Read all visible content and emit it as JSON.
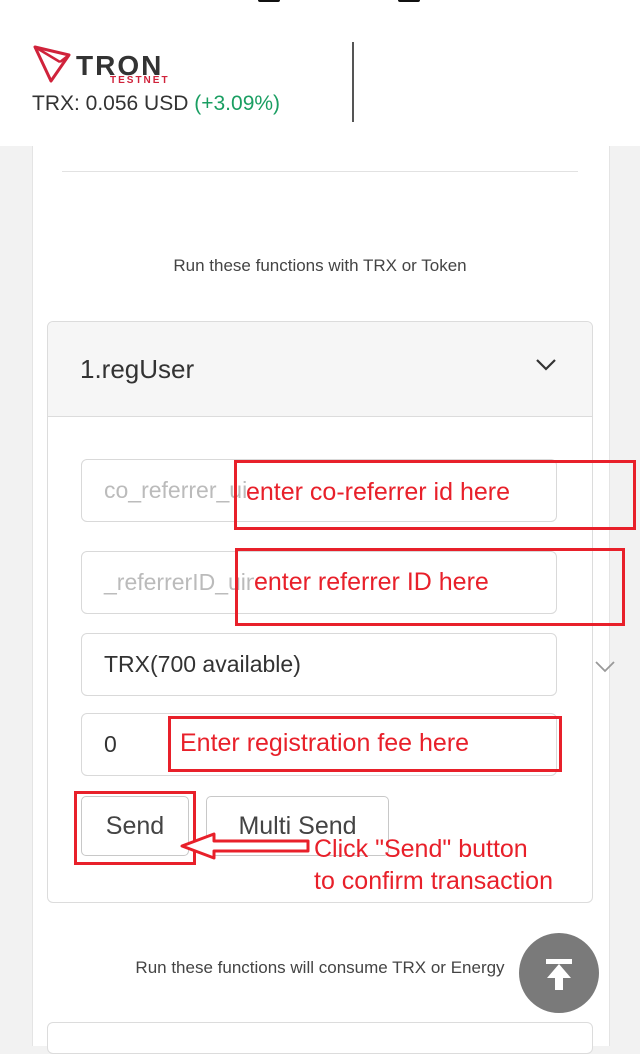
{
  "header": {
    "logo_word": "TRON",
    "logo_sub": "TESTNET",
    "price_label": "TRX: 0.056 USD",
    "price_change": "(+3.09%)",
    "brand_color": "#d0233b",
    "change_color": "#1a9e62"
  },
  "section_trx": {
    "caption": "Run these functions with TRX or Token"
  },
  "function_panel": {
    "title": "1.regUser",
    "co_referrer_placeholder": "co_referrer_uint256",
    "referrer_placeholder": "_referrerID_uint256",
    "token_select_value": "TRX(700 available)",
    "amount_value": "0",
    "send_label": "Send",
    "multi_send_label": "Multi Send"
  },
  "annotations": {
    "co_referrer": "enter co-referrer id here",
    "referrer": "enter referrer ID here",
    "fee": "Enter registration fee here",
    "send_line1": "Click \"Send\" button",
    "send_line2": "to confirm transaction",
    "color": "#e8202a"
  },
  "section_energy": {
    "caption": "Run these functions will consume TRX or Energy"
  },
  "icons": {
    "logo": "tron-logo-icon",
    "collapse": "chevron-down-icon",
    "select": "chevron-down-icon",
    "scroll_top": "arrow-up-icon"
  }
}
